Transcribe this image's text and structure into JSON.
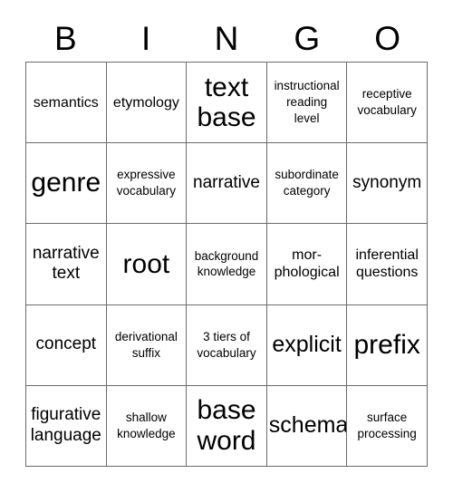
{
  "header": {
    "letters": [
      "B",
      "I",
      "N",
      "G",
      "O"
    ]
  },
  "grid": {
    "columns": 5,
    "rows": 5,
    "border_color": "#6b6b6b",
    "background_color": "#ffffff",
    "text_color": "#000000",
    "cells": [
      {
        "text": "semantics",
        "size": "sm"
      },
      {
        "text": "etymology",
        "size": "sm"
      },
      {
        "text": "text\nbase",
        "size": "xl"
      },
      {
        "text": "instructional\nreading\nlevel",
        "size": "xs"
      },
      {
        "text": "receptive\nvocabulary",
        "size": "xs"
      },
      {
        "text": "genre",
        "size": "xl"
      },
      {
        "text": "expressive\nvocabulary",
        "size": "xs"
      },
      {
        "text": "narrative",
        "size": "md"
      },
      {
        "text": "subordinate\ncategory",
        "size": "xs"
      },
      {
        "text": "synonym",
        "size": "md"
      },
      {
        "text": "narrative\ntext",
        "size": "md"
      },
      {
        "text": "root",
        "size": "xl"
      },
      {
        "text": "background\nknowledge",
        "size": "xs"
      },
      {
        "text": "mor-\nphological",
        "size": "sm"
      },
      {
        "text": "inferential\nquestions",
        "size": "sm"
      },
      {
        "text": "concept",
        "size": "md"
      },
      {
        "text": "derivational\nsuffix",
        "size": "xs"
      },
      {
        "text": "3 tiers of\nvocabulary",
        "size": "xs"
      },
      {
        "text": "explicit",
        "size": "lg"
      },
      {
        "text": "prefix",
        "size": "xl"
      },
      {
        "text": "figurative\nlanguage",
        "size": "md"
      },
      {
        "text": "shallow\nknowledge",
        "size": "xs"
      },
      {
        "text": "base\nword",
        "size": "xl"
      },
      {
        "text": "schema",
        "size": "lg"
      },
      {
        "text": "surface\nprocessing",
        "size": "xs"
      }
    ]
  }
}
